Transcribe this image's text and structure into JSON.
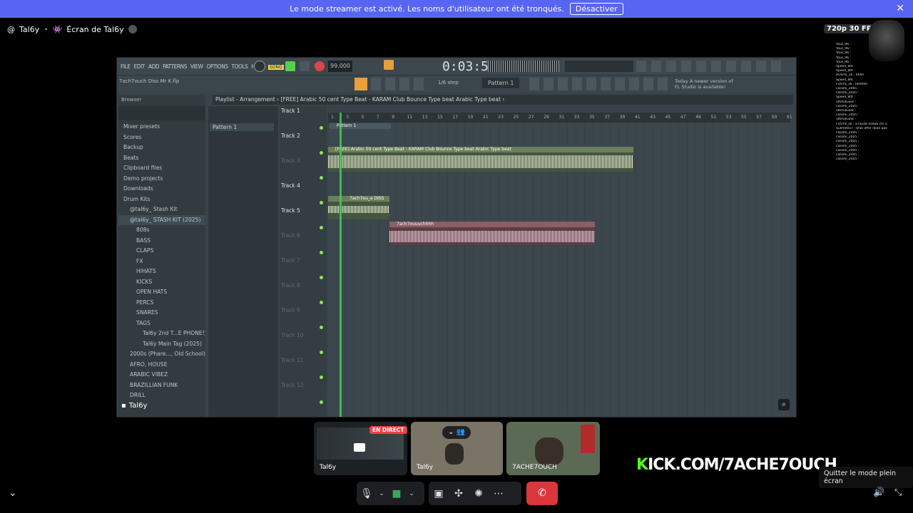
{
  "banner": {
    "text": "Le mode streamer est activé. Les noms d'utilisateur ont été tronqués.",
    "button": "Désactiver",
    "close": "✕"
  },
  "header": {
    "user": "Tal6y",
    "screen_title": "Écran de Tal6y",
    "quality_badge": "720p 30 FPS"
  },
  "chat_lines": [
    "Yous_96 :",
    "Yous_96 :",
    "Yous_96 :",
    "Yous_96 :",
    "Yous_96 :",
    "Speed_WX :",
    "Speed_WX :",
    "HOSY0_16 : hhhh",
    "Speed_WX :",
    "FOSY0_16 : hhhhhh",
    "cassmi_2005 :",
    "cassmi_2005 :",
    "Speed_WX :",
    "ultimaGolic :",
    "cassmi_2005 :",
    "ultimaGolic :",
    "cassmi_2005 :",
    "ultimaGolic :",
    "FOSY0_16 : a houte ezdub chi couplet",
    "Sullm0017 : khal offer ifjoid passe 90sd fruits fuitrra",
    "cassmi_2005 :",
    "cassmi_2005 :",
    "cassmi_2005 :",
    "cassmi_2005 :",
    "cassmi_2005 :",
    "cassmi_2005 :",
    "cassmi_2005 :"
  ],
  "fl": {
    "menu": [
      "FILE",
      "EDIT",
      "ADD",
      "PATTERNS",
      "VIEW",
      "OPTIONS",
      "TOOLS",
      "HELP"
    ],
    "song_mode": "SONG",
    "tempo": "99.000",
    "time": "0:03:51",
    "project_name": "7ach7ouch Diss Mr K.flp",
    "snap": "1/6 step",
    "pattern_select": "Pattern 1",
    "update_note": "Today  A newer version of FL Studio is available!",
    "browser_title": "Browser",
    "playlist_title": "Playlist - Arrangement › [FREE] Arabic 50 cent Type Beat - KARAM  Club Bounce Type beat  Arabic Type beat ›",
    "pattern_item": "Pattern 1",
    "browser_items": [
      {
        "label": "Mixer presets",
        "indent": 1
      },
      {
        "label": "Scores",
        "indent": 1
      },
      {
        "label": "Backup",
        "indent": 1
      },
      {
        "label": "Beats",
        "indent": 1
      },
      {
        "label": "Clipboard files",
        "indent": 1
      },
      {
        "label": "Demo projects",
        "indent": 1
      },
      {
        "label": "Downloads",
        "indent": 1
      },
      {
        "label": "Drum Kits",
        "indent": 1
      },
      {
        "label": "@tal6y_ Stash Kit",
        "indent": 2
      },
      {
        "label": "@tal6y_ STASH KIT (2025)",
        "indent": 2
      },
      {
        "label": "808s",
        "indent": 3
      },
      {
        "label": "BASS",
        "indent": 3
      },
      {
        "label": "CLAPS",
        "indent": 3
      },
      {
        "label": "FX",
        "indent": 3
      },
      {
        "label": "HIHATS",
        "indent": 3
      },
      {
        "label": "KICKS",
        "indent": 3
      },
      {
        "label": "OPEN HATS",
        "indent": 3
      },
      {
        "label": "PERCS",
        "indent": 3
      },
      {
        "label": "SNARES",
        "indent": 3
      },
      {
        "label": "TAGS",
        "indent": 3
      },
      {
        "label": "Tal6y 2nd T...E PHONE!)",
        "indent": 4
      },
      {
        "label": "Tal6y Main Tag (2025)",
        "indent": 4
      },
      {
        "label": "2000s (Phare..., Old School)",
        "indent": 2
      },
      {
        "label": "AFRO, HOUSE",
        "indent": 2
      },
      {
        "label": "ARABIC VIBEZ",
        "indent": 2
      },
      {
        "label": "BRAZILLIAN FUNK",
        "indent": 2
      },
      {
        "label": "DRILL",
        "indent": 2
      }
    ],
    "tracks": [
      "Track 1",
      "Track 2",
      "Track 3",
      "Track 4",
      "Track 5",
      "Track 6",
      "Track 7",
      "Track 8",
      "Track 9",
      "Track 10",
      "Track 11",
      "Track 12"
    ],
    "ruler": [
      "1",
      "3",
      "5",
      "7",
      "9",
      "11",
      "13",
      "15",
      "17",
      "19",
      "21",
      "23",
      "25",
      "27",
      "29",
      "31",
      "33",
      "35",
      "37",
      "39",
      "41",
      "43",
      "45",
      "47",
      "49",
      "51",
      "53",
      "55",
      "57",
      "59",
      "61"
    ],
    "clips": {
      "c1": "Pattern 1",
      "c2": "[FREE] Arabic 50 cent Type Beat - KARAM  Club Bounce Type beat  Arabic Type beat",
      "c3": "7ach7ou_a DISS",
      "c4": "7ach7ouuuchhhh"
    }
  },
  "screen_nameplate": "Tal6y",
  "tiles": [
    {
      "name": "Tal6y",
      "live": "EN DIRECT"
    },
    {
      "name": "Tal6y"
    },
    {
      "name": "7ACHE7OUCH"
    }
  ],
  "kick": {
    "k": "K",
    "rest": "ICK.COM/7ACHE7OUCH"
  },
  "tooltip": "Quitter le mode plein écran"
}
